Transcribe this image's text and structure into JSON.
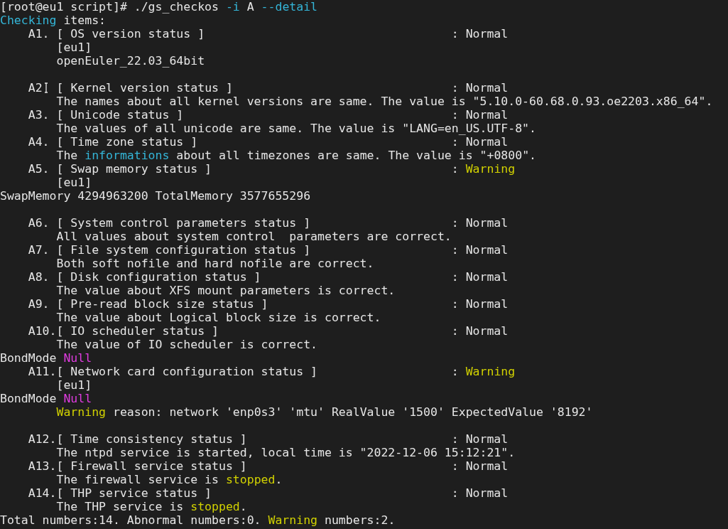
{
  "terminal": {
    "lines": [
      {
        "kind": "flush",
        "segments": [
          {
            "kind": "plain",
            "text": "[root@eu1 script]# ./gs_checkos "
          },
          {
            "kind": "accent",
            "text": "-i"
          },
          {
            "kind": "plain",
            "text": " A "
          },
          {
            "kind": "accent",
            "text": "--detail"
          }
        ]
      },
      {
        "kind": "flush",
        "segments": [
          {
            "kind": "accent",
            "text": "Checking"
          },
          {
            "kind": "plain",
            "text": " items:"
          }
        ]
      },
      {
        "kind": "item",
        "segments": [
          {
            "kind": "plain",
            "text": "A1. [ OS version status ]"
          }
        ],
        "status": [
          {
            "kind": "plain",
            "text": ": Normal"
          }
        ]
      },
      {
        "kind": "detail",
        "segments": [
          {
            "kind": "plain",
            "text": "[eu1]"
          }
        ]
      },
      {
        "kind": "detail",
        "segments": [
          {
            "kind": "plain",
            "text": "openEuler_22.03_64bit"
          }
        ]
      },
      {
        "kind": "blank"
      },
      {
        "kind": "item",
        "segments": [
          {
            "kind": "plain",
            "text": "A2"
          },
          {
            "kind": "cursor"
          },
          {
            "kind": "plain",
            "text": " [ Kernel version status ]"
          }
        ],
        "status": [
          {
            "kind": "plain",
            "text": ": Normal"
          }
        ]
      },
      {
        "kind": "detail",
        "segments": [
          {
            "kind": "plain",
            "text": "The names about all kernel versions are same. The value is \"5.10.0-60.68.0.93.oe2203.x86_64\"."
          }
        ]
      },
      {
        "kind": "item",
        "segments": [
          {
            "kind": "plain",
            "text": "A3. [ Unicode status ]"
          }
        ],
        "status": [
          {
            "kind": "plain",
            "text": ": Normal"
          }
        ]
      },
      {
        "kind": "detail",
        "segments": [
          {
            "kind": "plain",
            "text": "The values of all unicode are same. The value is \"LANG=en_US.UTF-8\"."
          }
        ]
      },
      {
        "kind": "item",
        "segments": [
          {
            "kind": "plain",
            "text": "A4. [ Time zone status ]"
          }
        ],
        "status": [
          {
            "kind": "plain",
            "text": ": Normal"
          }
        ]
      },
      {
        "kind": "detail",
        "segments": [
          {
            "kind": "plain",
            "text": "The "
          },
          {
            "kind": "accent",
            "text": "informations"
          },
          {
            "kind": "plain",
            "text": " about all timezones are same. The value is \"+0800\"."
          }
        ]
      },
      {
        "kind": "item",
        "segments": [
          {
            "kind": "plain",
            "text": "A5. [ Swap memory status ]"
          }
        ],
        "status": [
          {
            "kind": "plain",
            "text": ": "
          },
          {
            "kind": "warn",
            "text": "Warning"
          }
        ]
      },
      {
        "kind": "detail",
        "segments": [
          {
            "kind": "plain",
            "text": "[eu1]"
          }
        ]
      },
      {
        "kind": "flush",
        "segments": [
          {
            "kind": "plain",
            "text": "SwapMemory 4294963200 TotalMemory 3577655296"
          }
        ]
      },
      {
        "kind": "blank"
      },
      {
        "kind": "item",
        "segments": [
          {
            "kind": "plain",
            "text": "A6. [ System control parameters status ]"
          }
        ],
        "status": [
          {
            "kind": "plain",
            "text": ": Normal"
          }
        ]
      },
      {
        "kind": "detail",
        "segments": [
          {
            "kind": "plain",
            "text": "All values about system control  parameters are correct."
          }
        ]
      },
      {
        "kind": "item",
        "segments": [
          {
            "kind": "plain",
            "text": "A7. [ File system configuration status ]"
          }
        ],
        "status": [
          {
            "kind": "plain",
            "text": ": Normal"
          }
        ]
      },
      {
        "kind": "detail",
        "segments": [
          {
            "kind": "plain",
            "text": "Both soft nofile and hard nofile are correct."
          }
        ]
      },
      {
        "kind": "item",
        "segments": [
          {
            "kind": "plain",
            "text": "A8. [ Disk configuration status ]"
          }
        ],
        "status": [
          {
            "kind": "plain",
            "text": ": Normal"
          }
        ]
      },
      {
        "kind": "detail",
        "segments": [
          {
            "kind": "plain",
            "text": "The value about XFS mount parameters is correct."
          }
        ]
      },
      {
        "kind": "item",
        "segments": [
          {
            "kind": "plain",
            "text": "A9. [ Pre-read block size status ]"
          }
        ],
        "status": [
          {
            "kind": "plain",
            "text": ": Normal"
          }
        ]
      },
      {
        "kind": "detail",
        "segments": [
          {
            "kind": "plain",
            "text": "The value about Logical block size is correct."
          }
        ]
      },
      {
        "kind": "item",
        "segments": [
          {
            "kind": "plain",
            "text": "A10.[ IO scheduler status ]"
          }
        ],
        "status": [
          {
            "kind": "plain",
            "text": ": Normal"
          }
        ]
      },
      {
        "kind": "detail",
        "segments": [
          {
            "kind": "plain",
            "text": "The value of IO scheduler is correct."
          }
        ]
      },
      {
        "kind": "flush",
        "segments": [
          {
            "kind": "plain",
            "text": "BondMode "
          },
          {
            "kind": "null",
            "text": "Null"
          }
        ]
      },
      {
        "kind": "item",
        "segments": [
          {
            "kind": "plain",
            "text": "A11.[ Network card configuration status ]"
          }
        ],
        "status": [
          {
            "kind": "plain",
            "text": ": "
          },
          {
            "kind": "warn",
            "text": "Warning"
          }
        ]
      },
      {
        "kind": "detail",
        "segments": [
          {
            "kind": "plain",
            "text": "[eu1]"
          }
        ]
      },
      {
        "kind": "flush",
        "segments": [
          {
            "kind": "plain",
            "text": "BondMode "
          },
          {
            "kind": "null",
            "text": "Null"
          }
        ]
      },
      {
        "kind": "detail",
        "segments": [
          {
            "kind": "warn",
            "text": "Warning"
          },
          {
            "kind": "plain",
            "text": " reason: network 'enp0s3' 'mtu' RealValue '1500' ExpectedValue '8192'"
          }
        ]
      },
      {
        "kind": "blank"
      },
      {
        "kind": "item",
        "segments": [
          {
            "kind": "plain",
            "text": "A12.[ Time consistency status ]"
          }
        ],
        "status": [
          {
            "kind": "plain",
            "text": ": Normal"
          }
        ]
      },
      {
        "kind": "detail",
        "segments": [
          {
            "kind": "plain",
            "text": "The ntpd service is started, local time is \"2022-12-06 15:12:21\"."
          }
        ]
      },
      {
        "kind": "item",
        "segments": [
          {
            "kind": "plain",
            "text": "A13.[ Firewall service status ]"
          }
        ],
        "status": [
          {
            "kind": "plain",
            "text": ": Normal"
          }
        ]
      },
      {
        "kind": "detail",
        "segments": [
          {
            "kind": "plain",
            "text": "The firewall service is "
          },
          {
            "kind": "warn",
            "text": "stopped"
          },
          {
            "kind": "plain",
            "text": "."
          }
        ]
      },
      {
        "kind": "item",
        "segments": [
          {
            "kind": "plain",
            "text": "A14.[ THP service status ]"
          }
        ],
        "status": [
          {
            "kind": "plain",
            "text": ": Normal"
          }
        ]
      },
      {
        "kind": "detail",
        "segments": [
          {
            "kind": "plain",
            "text": "The THP service is "
          },
          {
            "kind": "warn",
            "text": "stopped"
          },
          {
            "kind": "plain",
            "text": "."
          }
        ]
      },
      {
        "kind": "flush",
        "segments": [
          {
            "kind": "plain",
            "text": "Total numbers:14. Abnormal numbers:0. "
          },
          {
            "kind": "warn",
            "text": "Warning"
          },
          {
            "kind": "plain",
            "text": " numbers:2."
          }
        ]
      }
    ]
  }
}
